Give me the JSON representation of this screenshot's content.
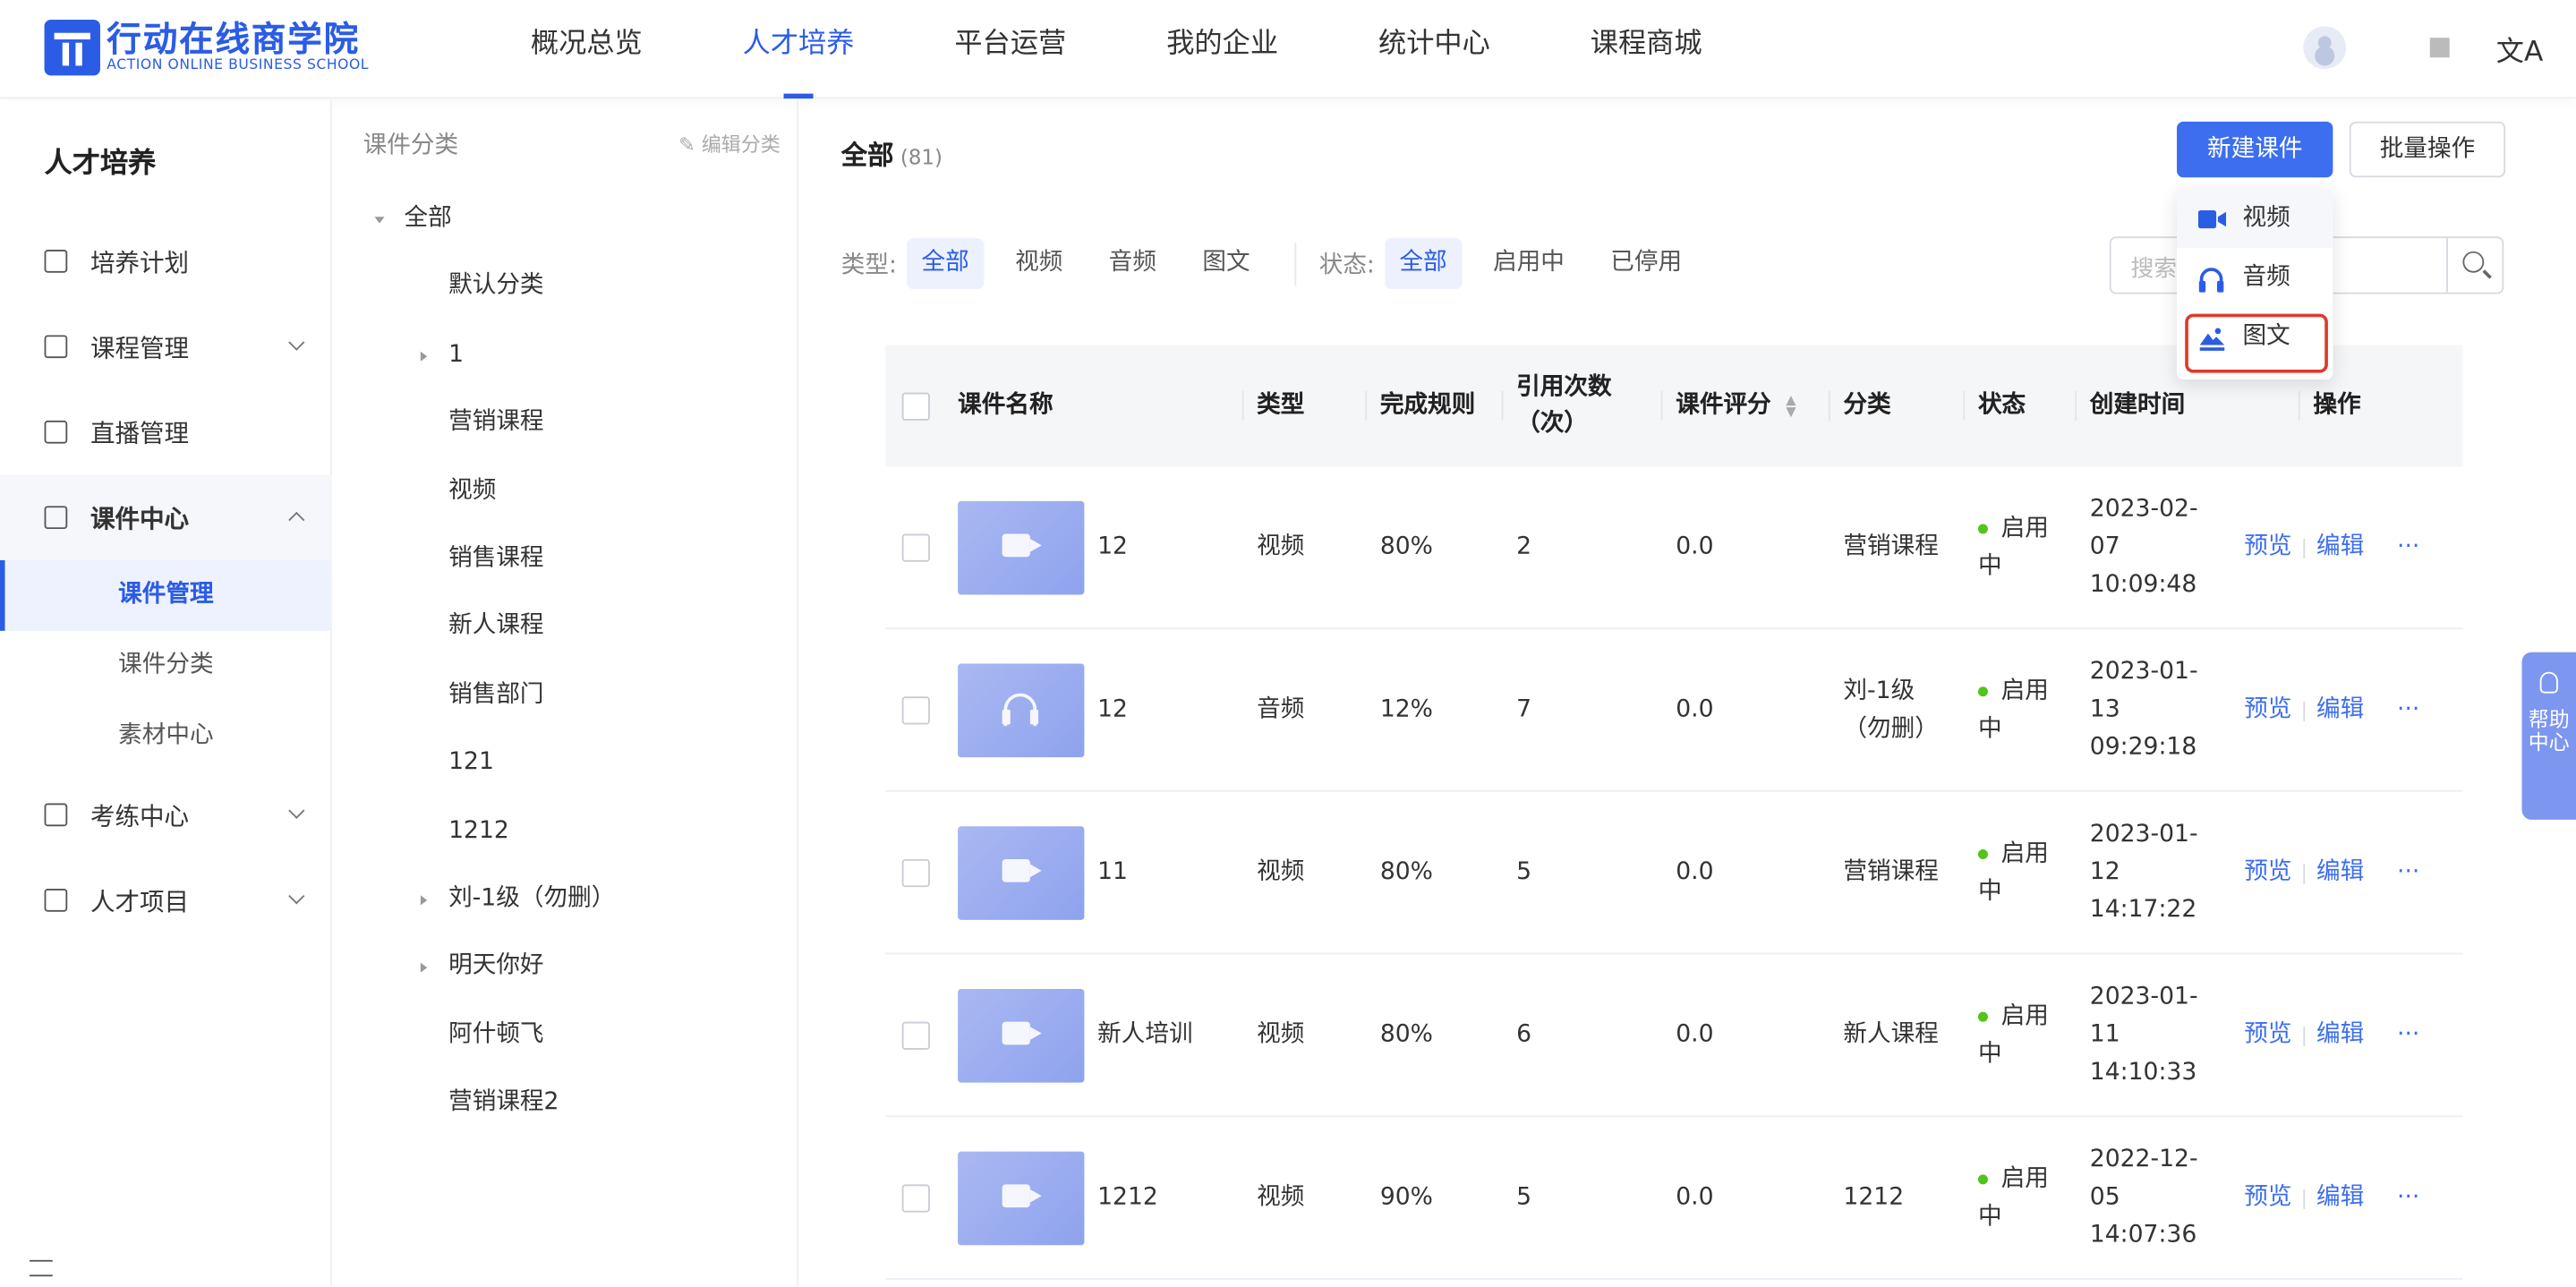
{
  "header": {
    "logo_cn": "行动在线商学院",
    "logo_en": "ACTION ONLINE BUSINESS SCHOOL",
    "nav": [
      "概况总览",
      "人才培养",
      "平台运营",
      "我的企业",
      "统计中心",
      "课程商城"
    ],
    "active_nav": "人才培养",
    "lang_icon": "文A"
  },
  "sidebar": {
    "title": "人才培养",
    "items": [
      {
        "label": "培养计划"
      },
      {
        "label": "课程管理"
      },
      {
        "label": "直播管理"
      },
      {
        "label": "课件中心"
      },
      {
        "label": "考练中心"
      },
      {
        "label": "人才项目"
      }
    ],
    "sub_items": [
      "课件管理",
      "课件分类",
      "素材中心"
    ],
    "active_sub": "课件管理"
  },
  "category": {
    "title": "课件分类",
    "edit_label": "编辑分类",
    "nodes": [
      "全部",
      "默认分类",
      "1",
      "营销课程",
      "视频",
      "销售课程",
      "新人课程",
      "销售部门",
      "121",
      "1212",
      "刘-1级（勿删）",
      "明天你好",
      "阿什顿飞",
      "营销课程2"
    ]
  },
  "main": {
    "title": "全部",
    "count": "(81)",
    "new_button": "新建课件",
    "batch_button": "批量操作",
    "type_label": "类型:",
    "type_options": [
      "全部",
      "视频",
      "音频",
      "图文"
    ],
    "status_label": "状态:",
    "status_options": [
      "全部",
      "启用中",
      "已停用"
    ],
    "search_placeholder": "搜索",
    "dropdown": [
      "视频",
      "音频",
      "图文"
    ]
  },
  "table": {
    "headers": [
      "课件名称",
      "类型",
      "完成规则",
      "引用次数（次）",
      "课件评分",
      "分类",
      "状态",
      "创建时间",
      "操作"
    ],
    "rows": [
      {
        "name": "12",
        "type": "视频",
        "rule": "80%",
        "refs": "2",
        "score": "0.0",
        "category": "营销课程",
        "status": "启用中",
        "created": "2023-02-07 10:09:48",
        "thumb": "video"
      },
      {
        "name": "12",
        "type": "音频",
        "rule": "12%",
        "refs": "7",
        "score": "0.0",
        "category": "刘-1级（勿删）",
        "status": "启用中",
        "created": "2023-01-13 09:29:18",
        "thumb": "audio"
      },
      {
        "name": "11",
        "type": "视频",
        "rule": "80%",
        "refs": "5",
        "score": "0.0",
        "category": "营销课程",
        "status": "启用中",
        "created": "2023-01-12 14:17:22",
        "thumb": "video"
      },
      {
        "name": "新人培训",
        "type": "视频",
        "rule": "80%",
        "refs": "6",
        "score": "0.0",
        "category": "新人课程",
        "status": "启用中",
        "created": "2023-01-11 14:10:33",
        "thumb": "video"
      },
      {
        "name": "1212",
        "type": "视频",
        "rule": "90%",
        "refs": "5",
        "score": "0.0",
        "category": "1212",
        "status": "启用中",
        "created": "2022-12-05 14:07:36",
        "thumb": "video"
      }
    ],
    "ops": {
      "preview": "预览",
      "edit": "编辑",
      "more": "···"
    }
  },
  "help": {
    "label": "帮助中心"
  },
  "colors": {
    "primary": "#3d6ef0",
    "highlight": "#e03a2a",
    "status_dot": "#52c41a"
  }
}
